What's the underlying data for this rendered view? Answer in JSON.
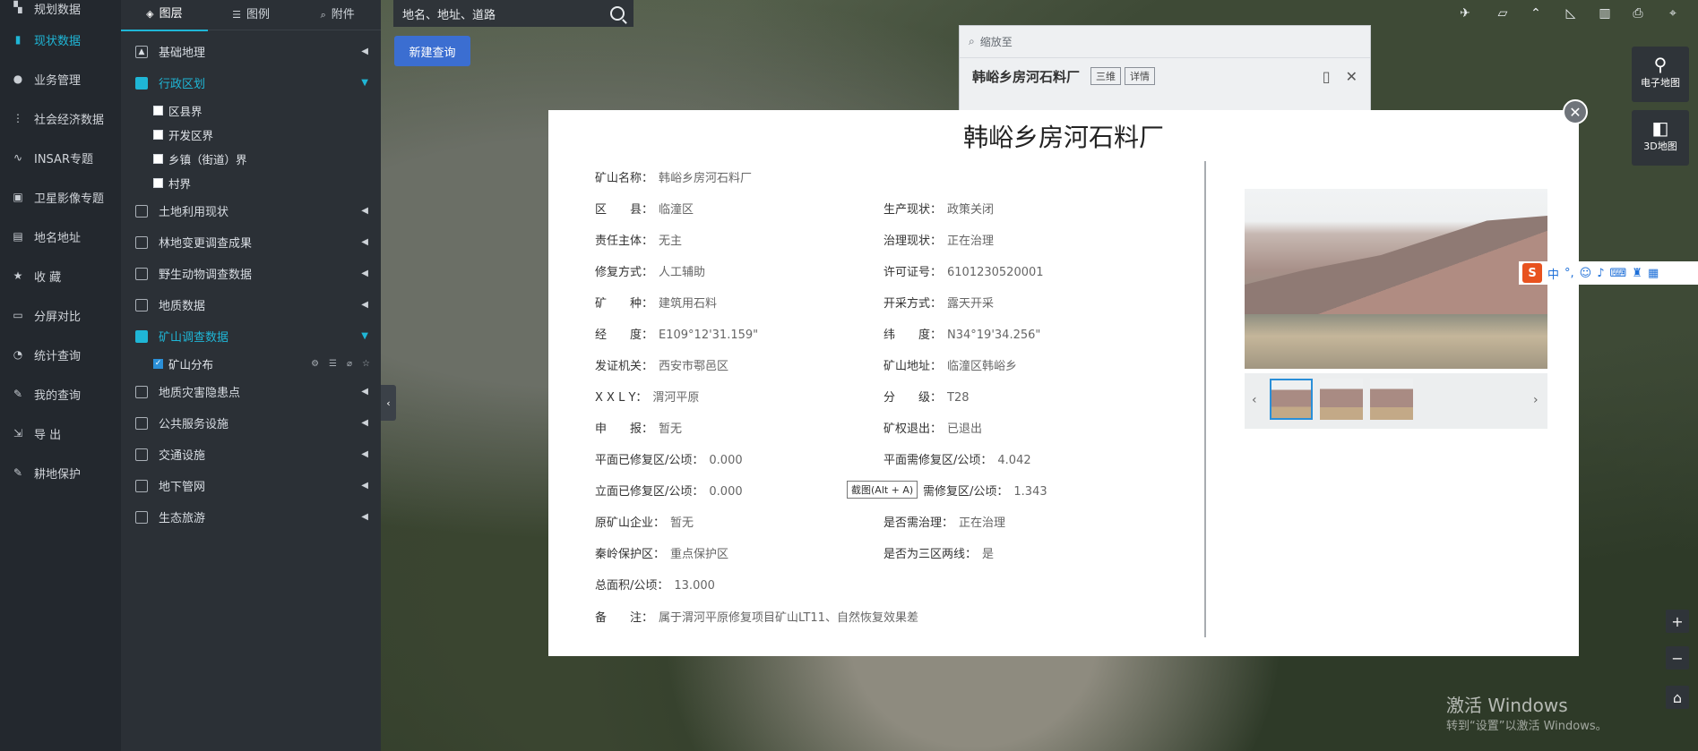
{
  "nav": [
    {
      "label": "规划数据",
      "icon": "planning-data-icon",
      "glyph": "▚"
    },
    {
      "label": "现状数据",
      "icon": "bar-chart-icon",
      "glyph": "▮",
      "active": true
    },
    {
      "label": "业务管理",
      "icon": "user-icon",
      "glyph": "●"
    },
    {
      "label": "社会经济数据",
      "icon": "economy-icon",
      "glyph": "⋮"
    },
    {
      "label": "INSAR专题",
      "icon": "wave-icon",
      "glyph": "∿"
    },
    {
      "label": "卫星影像专题",
      "icon": "satellite-image-icon",
      "glyph": "▣"
    },
    {
      "label": "地名地址",
      "icon": "place-icon",
      "glyph": "▤"
    },
    {
      "label": "收 藏",
      "icon": "star-icon",
      "glyph": "★"
    },
    {
      "label": "分屏对比",
      "icon": "monitor-icon",
      "glyph": "▭"
    },
    {
      "label": "统计查询",
      "icon": "pie-icon",
      "glyph": "◔"
    },
    {
      "label": "我的查询",
      "icon": "query-icon",
      "glyph": "✎"
    },
    {
      "label": "导 出",
      "icon": "export-icon",
      "glyph": "⇲"
    },
    {
      "label": "耕地保护",
      "icon": "farmland-icon",
      "glyph": "✎"
    }
  ],
  "tabs": [
    {
      "label": "图层",
      "glyph": "◈"
    },
    {
      "label": "图例",
      "glyph": "☰"
    },
    {
      "label": "附件",
      "glyph": "⌕"
    }
  ],
  "layers": {
    "group1": [
      {
        "label": "基础地理",
        "glyph": "▲"
      },
      {
        "label": "行政区划",
        "glyph": "▮",
        "open": true
      }
    ],
    "admin_sub": [
      "区县界",
      "开发区界",
      "乡镇（街道）界",
      "村界"
    ],
    "group2": [
      "土地利用现状",
      "林地变更调查成果",
      "野生动物调查数据",
      "地质数据"
    ],
    "mine": {
      "label": "矿山调查数据",
      "sub": "矿山分布"
    },
    "group3": [
      "地质灾害隐患点",
      "公共服务设施",
      "交通设施",
      "地下管网",
      "生态旅游"
    ]
  },
  "search": {
    "placeholder": "地名、地址、道路"
  },
  "new_query": "新建查询",
  "zoom_panel": {
    "zoom_label": "缩放至",
    "title": "韩峪乡房河石料厂",
    "btn_3d": "三维",
    "btn_detail": "详情"
  },
  "map_buttons": {
    "e_map": "电子地图",
    "map_3d": "3D地图"
  },
  "watermark": {
    "line1": "激活 Windows",
    "line2": "转到“设置”以激活 Windows。"
  },
  "modal": {
    "title": "韩峪乡房河石料厂",
    "left": [
      {
        "k": "矿山名称：",
        "v": "韩峪乡房河石料厂"
      },
      {
        "k": "区　　县：",
        "v": "临潼区"
      },
      {
        "k": "责任主体：",
        "v": "无主"
      },
      {
        "k": "修复方式：",
        "v": "人工辅助"
      },
      {
        "k": "矿　　种：",
        "v": "建筑用石料"
      },
      {
        "k": "经　　度：",
        "v": "E109°12'31.159\""
      },
      {
        "k": "发证机关：",
        "v": "西安市鄠邑区"
      },
      {
        "k": "X X L Y：",
        "v": "渭河平原"
      },
      {
        "k": "申　　报：",
        "v": "暂无"
      },
      {
        "k": "平面已修复区/公顷：",
        "v": "0.000"
      },
      {
        "k": "立面已修复区/公顷：",
        "v": "0.000"
      },
      {
        "k": "原矿山企业：",
        "v": "暂无"
      },
      {
        "k": "秦岭保护区：",
        "v": "重点保护区"
      },
      {
        "k": "总面积/公顷：",
        "v": "13.000"
      },
      {
        "k": "备　　注：",
        "v": "属于渭河平原修复项目矿山LT11、自然恢复效果差"
      }
    ],
    "right": [
      {
        "k": "生产现状：",
        "v": "政策关闭"
      },
      {
        "k": "治理现状：",
        "v": "正在治理"
      },
      {
        "k": "许可证号：",
        "v": "6101230520001"
      },
      {
        "k": "开采方式：",
        "v": "露天开采"
      },
      {
        "k": "纬　　度：",
        "v": "N34°19'34.256\""
      },
      {
        "k": "矿山地址：",
        "v": "临潼区韩峪乡"
      },
      {
        "k": "分　　级：",
        "v": "T28"
      },
      {
        "k": "矿权退出：",
        "v": "已退出"
      },
      {
        "k": "平面需修复区/公顷：",
        "v": "4.042"
      },
      {
        "k": "需修复区/公顷：",
        "v": "1.343"
      },
      {
        "k": "是否需治理：",
        "v": "正在治理"
      },
      {
        "k": "是否为三区两线：",
        "v": "是"
      }
    ],
    "tooltip": "截图(Alt + A)"
  },
  "ime": {
    "s": "S",
    "zh": "中"
  }
}
